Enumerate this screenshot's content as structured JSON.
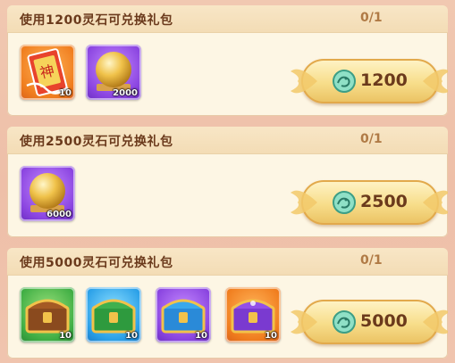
{
  "packs": [
    {
      "title": "使用1200灵石可兑换礼包",
      "progress": "0/1",
      "price": "1200",
      "items": [
        {
          "icon": "divine-scroll-icon",
          "qty": "10"
        },
        {
          "icon": "golden-orb-icon",
          "qty": "2000"
        }
      ]
    },
    {
      "title": "使用2500灵石可兑换礼包",
      "progress": "0/1",
      "price": "2500",
      "items": [
        {
          "icon": "golden-orb-icon",
          "qty": "6000"
        }
      ]
    },
    {
      "title": "使用5000灵石可兑换礼包",
      "progress": "0/1",
      "price": "5000",
      "items": [
        {
          "icon": "green-chest-icon",
          "qty": "10"
        },
        {
          "icon": "green-chest-icon",
          "qty": "10"
        },
        {
          "icon": "blue-chest-icon",
          "qty": "10"
        },
        {
          "icon": "purple-chest-icon",
          "qty": "10"
        }
      ]
    }
  ],
  "currency_icon": "spirit-stone-dragon-icon",
  "colors": {
    "title": "#6b3a1c",
    "progress": "#b07a45",
    "card_bg": "#fdf6e4",
    "button_gold": "#f7dd8a"
  }
}
